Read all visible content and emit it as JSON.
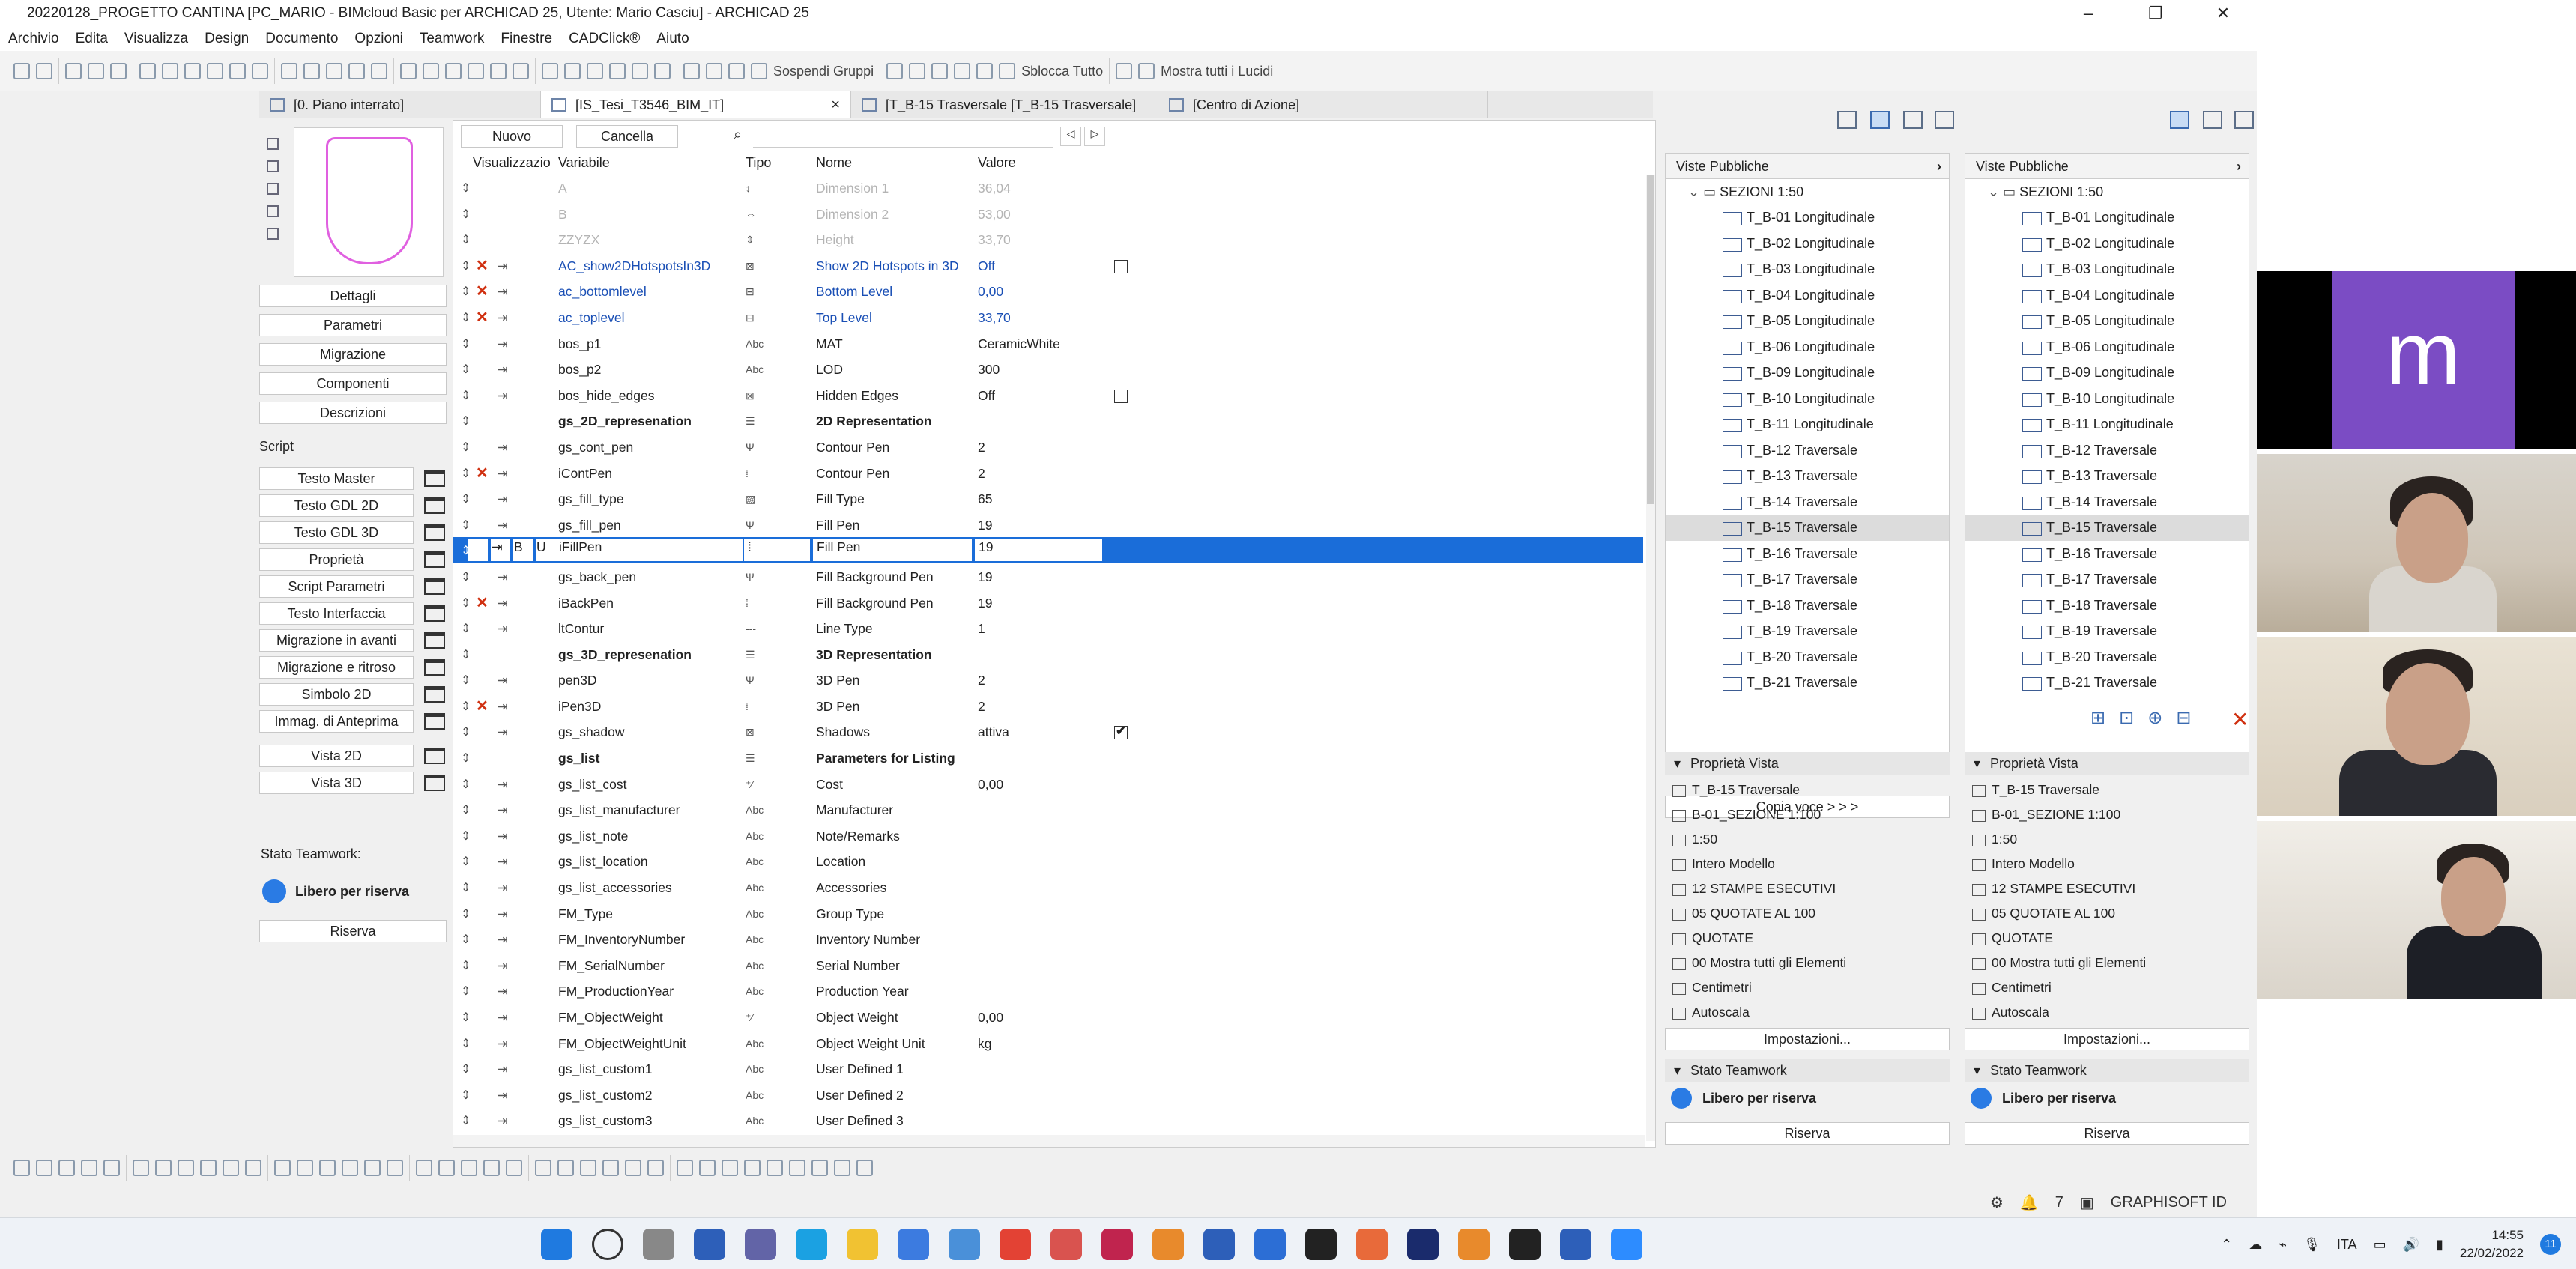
{
  "window": {
    "title": "20220128_PROGETTO CANTINA [PC_MARIO - BIMcloud Basic per ARCHICAD 25, Utente: Mario Casciu] - ARCHICAD 25",
    "min": "–",
    "max": "❐",
    "close": "✕"
  },
  "menu": [
    "Archivio",
    "Edita",
    "Visualizza",
    "Design",
    "Documento",
    "Opzioni",
    "Teamwork",
    "Finestre",
    "CADClick®",
    "Aiuto"
  ],
  "toolbar": {
    "suspend_groups": "Sospendi Gruppi",
    "unlock_all": "Sblocca Tutto",
    "show_all_layers": "Mostra tutti i Lucidi"
  },
  "tabs": [
    {
      "label": "[0. Piano interrato]",
      "close": ""
    },
    {
      "label": "[IS_Tesi_T3546_BIM_IT]",
      "close": "×"
    },
    {
      "label": "[T_B-15 Trasversale [T_B-15 Trasversale]",
      "close": ""
    },
    {
      "label": "[Centro di Azione]",
      "close": ""
    }
  ],
  "left_panel": {
    "buttons": [
      "Dettagli",
      "Parametri",
      "Migrazione",
      "Componenti",
      "Descrizioni"
    ],
    "script_label": "Script",
    "scripts": [
      "Testo Master",
      "Testo GDL 2D",
      "Testo GDL 3D",
      "Proprietà",
      "Script Parametri",
      "Testo Interfaccia",
      "Migrazione in avanti",
      "Migrazione e ritroso",
      "Simbolo 2D",
      "Immag. di Anteprima"
    ],
    "views": [
      "Vista 2D",
      "Vista 3D"
    ],
    "teamwork_label": "Stato Teamwork:",
    "teamwork_state": "Libero per riserva",
    "reserve": "Riserva"
  },
  "editor": {
    "new_button": "Nuovo",
    "cancel_button": "Cancella",
    "search_placeholder": "",
    "columns": {
      "vis": "Visualizzazio",
      "var": "Variabile",
      "type": "Tipo",
      "name": "Nome",
      "value": "Valore"
    },
    "rows": [
      {
        "var": "A",
        "type": "↕",
        "name": "Dimension 1",
        "value": "36,04",
        "style": "dis",
        "x": false,
        "cb": null
      },
      {
        "var": "B",
        "type": "⇔",
        "name": "Dimension 2",
        "value": "53,00",
        "style": "dis",
        "x": false,
        "cb": null
      },
      {
        "var": "ZZYZX",
        "type": "⇕",
        "name": "Height",
        "value": "33,70",
        "style": "dis",
        "x": false,
        "cb": null
      },
      {
        "var": "AC_show2DHotspotsIn3D",
        "type": "⊠",
        "name": "Show 2D Hotspots in 3D",
        "value": "Off",
        "style": "blue",
        "x": true,
        "cb": false
      },
      {
        "var": "ac_bottomlevel",
        "type": "⊟",
        "name": "Bottom Level",
        "value": "0,00",
        "style": "blue",
        "x": true,
        "cb": null
      },
      {
        "var": "ac_toplevel",
        "type": "⊟",
        "name": "Top Level",
        "value": "33,70",
        "style": "blue",
        "x": true,
        "cb": null
      },
      {
        "var": "bos_p1",
        "type": "Abc",
        "name": "MAT",
        "value": "CeramicWhite",
        "style": "",
        "x": false,
        "cb": null
      },
      {
        "var": "bos_p2",
        "type": "Abc",
        "name": "LOD",
        "value": "300",
        "style": "",
        "x": false,
        "cb": null
      },
      {
        "var": "bos_hide_edges",
        "type": "⊠",
        "name": "Hidden Edges",
        "value": "Off",
        "style": "",
        "x": false,
        "cb": false
      },
      {
        "var": "gs_2D_represenation",
        "type": "☰",
        "name": "2D Representation",
        "value": "",
        "style": "bold",
        "x": false,
        "cb": null
      },
      {
        "var": "gs_cont_pen",
        "type": "Ψ",
        "name": "Contour Pen",
        "value": "2",
        "style": "",
        "x": false,
        "cb": null
      },
      {
        "var": "iContPen",
        "type": "⁞",
        "name": "Contour Pen",
        "value": "2",
        "style": "",
        "x": true,
        "cb": null
      },
      {
        "var": "gs_fill_type",
        "type": "▨",
        "name": "Fill Type",
        "value": "65",
        "style": "",
        "x": false,
        "cb": null
      },
      {
        "var": "gs_fill_pen",
        "type": "Ψ",
        "name": "Fill Pen",
        "value": "19",
        "style": "",
        "x": false,
        "cb": null
      },
      {
        "var": "iFillPen",
        "type": "⁞",
        "name": "Fill Pen",
        "value": "19",
        "style": "sel",
        "x": true,
        "cb": null
      },
      {
        "var": "gs_back_pen",
        "type": "Ψ",
        "name": "Fill Background Pen",
        "value": "19",
        "style": "",
        "x": false,
        "cb": null
      },
      {
        "var": "iBackPen",
        "type": "⁞",
        "name": "Fill Background Pen",
        "value": "19",
        "style": "",
        "x": true,
        "cb": null
      },
      {
        "var": "ltContur",
        "type": "---",
        "name": "Line Type",
        "value": "1",
        "style": "",
        "x": false,
        "cb": null
      },
      {
        "var": "gs_3D_represenation",
        "type": "☰",
        "name": "3D Representation",
        "value": "",
        "style": "bold",
        "x": false,
        "cb": null
      },
      {
        "var": "pen3D",
        "type": "Ψ",
        "name": "3D Pen",
        "value": "2",
        "style": "",
        "x": false,
        "cb": null
      },
      {
        "var": "iPen3D",
        "type": "⁞",
        "name": "3D Pen",
        "value": "2",
        "style": "",
        "x": true,
        "cb": null
      },
      {
        "var": "gs_shadow",
        "type": "⊠",
        "name": "Shadows",
        "value": "attiva",
        "style": "",
        "x": false,
        "cb": true
      },
      {
        "var": "gs_list",
        "type": "☰",
        "name": "Parameters for Listing",
        "value": "",
        "style": "bold",
        "x": false,
        "cb": null
      },
      {
        "var": "gs_list_cost",
        "type": "⁺⁄",
        "name": "Cost",
        "value": "0,00",
        "style": "",
        "x": false,
        "cb": null
      },
      {
        "var": "gs_list_manufacturer",
        "type": "Abc",
        "name": "Manufacturer",
        "value": "",
        "style": "",
        "x": false,
        "cb": null
      },
      {
        "var": "gs_list_note",
        "type": "Abc",
        "name": "Note/Remarks",
        "value": "",
        "style": "",
        "x": false,
        "cb": null
      },
      {
        "var": "gs_list_location",
        "type": "Abc",
        "name": "Location",
        "value": "",
        "style": "",
        "x": false,
        "cb": null
      },
      {
        "var": "gs_list_accessories",
        "type": "Abc",
        "name": "Accessories",
        "value": "",
        "style": "",
        "x": false,
        "cb": null
      },
      {
        "var": "FM_Type",
        "type": "Abc",
        "name": "Group Type",
        "value": "",
        "style": "",
        "x": false,
        "cb": null
      },
      {
        "var": "FM_InventoryNumber",
        "type": "Abc",
        "name": "Inventory Number",
        "value": "",
        "style": "",
        "x": false,
        "cb": null
      },
      {
        "var": "FM_SerialNumber",
        "type": "Abc",
        "name": "Serial Number",
        "value": "",
        "style": "",
        "x": false,
        "cb": null
      },
      {
        "var": "FM_ProductionYear",
        "type": "Abc",
        "name": "Production Year",
        "value": "",
        "style": "",
        "x": false,
        "cb": null
      },
      {
        "var": "FM_ObjectWeight",
        "type": "⁺⁄",
        "name": "Object Weight",
        "value": "0,00",
        "style": "",
        "x": false,
        "cb": null
      },
      {
        "var": "FM_ObjectWeightUnit",
        "type": "Abc",
        "name": "Object Weight Unit",
        "value": "kg",
        "style": "",
        "x": false,
        "cb": null
      },
      {
        "var": "gs_list_custom1",
        "type": "Abc",
        "name": "User Defined 1",
        "value": "",
        "style": "",
        "x": false,
        "cb": null
      },
      {
        "var": "gs_list_custom2",
        "type": "Abc",
        "name": "User Defined 2",
        "value": "",
        "style": "",
        "x": false,
        "cb": null
      },
      {
        "var": "gs_list_custom3",
        "type": "Abc",
        "name": "User Defined 3",
        "value": "",
        "style": "",
        "x": false,
        "cb": null
      }
    ],
    "selected_row_flags": [
      "B",
      "U"
    ]
  },
  "navigator": {
    "header": "Viste Pubbliche",
    "folder": "SEZIONI 1:50",
    "items": [
      "T_B-01 Longitudinale",
      "T_B-02 Longitudinale",
      "T_B-03 Longitudinale",
      "T_B-04 Longitudinale",
      "T_B-05 Longitudinale",
      "T_B-06 Longitudinale",
      "T_B-09 Longitudinale",
      "T_B-10 Longitudinale",
      "T_B-11 Longitudinale",
      "T_B-12 Traversale",
      "T_B-13 Traversale",
      "T_B-14 Traversale",
      "T_B-15 Traversale",
      "T_B-16 Traversale",
      "T_B-17 Traversale",
      "T_B-18 Traversale",
      "T_B-19 Traversale",
      "T_B-20 Traversale",
      "T_B-21 Traversale"
    ],
    "selected": "T_B-15 Traversale",
    "copy_button": "Copia voce > > >"
  },
  "view_properties": {
    "title": "Proprietà Vista",
    "rows": [
      "T_B-15 Traversale",
      "B-01_SEZIONE 1:100",
      "1:50",
      "Intero Modello",
      "12 STAMPE ESECUTIVI",
      "05 QUOTATE AL 100",
      "QUOTATE",
      "00 Mostra tutti gli Elementi",
      "Centimetri",
      "Autoscala"
    ],
    "settings_button": "Impostazioni...",
    "teamwork_title": "Stato Teamwork",
    "teamwork_state": "Libero per riserva",
    "reserve": "Riserva"
  },
  "statusbar": {
    "notifications": "7",
    "brand": "GRAPHISOFT ID"
  },
  "video": {
    "initial": "m"
  },
  "taskbar": {
    "lang": "ITA",
    "time": "14:55",
    "date": "22/02/2022",
    "badge": "11"
  },
  "colors": {
    "selection": "#1a6dd9",
    "link_blue": "#1a4fb5",
    "delete_red": "#d03010",
    "teamwork_dot": "#2a7be4",
    "video_tile": "#7b4cc4"
  }
}
